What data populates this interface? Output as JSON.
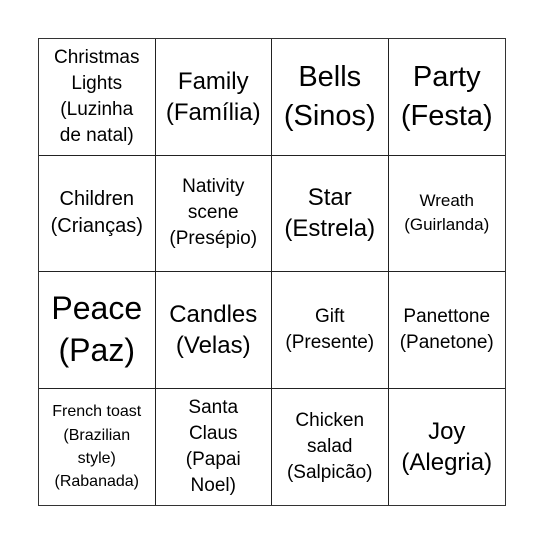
{
  "board": {
    "cells": [
      {
        "text": "Christmas\nLights\n(Luzinha\nde natal)"
      },
      {
        "text": "Family\n(Família)"
      },
      {
        "text": "Bells\n(Sinos)"
      },
      {
        "text": "Party\n(Festa)"
      },
      {
        "text": "Children\n(Crianças)"
      },
      {
        "text": "Nativity\nscene\n(Presépio)"
      },
      {
        "text": "Star\n(Estrela)"
      },
      {
        "text": "Wreath\n(Guirlanda)"
      },
      {
        "text": "Peace\n(Paz)"
      },
      {
        "text": "Candles\n(Velas)"
      },
      {
        "text": "Gift\n(Presente)"
      },
      {
        "text": "Panettone\n(Panetone)"
      },
      {
        "text": "French toast\n(Brazilian\nstyle)\n(Rabanada)"
      },
      {
        "text": "Santa\nClaus\n(Papai\nNoel)"
      },
      {
        "text": "Chicken\nsalad\n(Salpicão)"
      },
      {
        "text": "Joy\n(Alegria)"
      }
    ]
  }
}
